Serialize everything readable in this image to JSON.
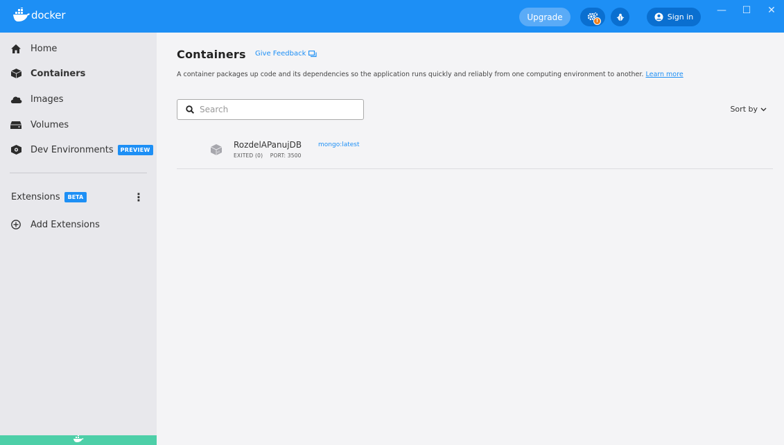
{
  "titlebar": {
    "logo_text": "docker",
    "upgrade_label": "Upgrade",
    "notification_count": "!",
    "signin_label": "Sign in",
    "minimize_glyph": "—",
    "maximize_glyph": "☐",
    "close_glyph": "✕"
  },
  "sidebar": {
    "items": [
      {
        "label": "Home",
        "icon": "home-icon"
      },
      {
        "label": "Containers",
        "icon": "containers-icon"
      },
      {
        "label": "Images",
        "icon": "images-icon"
      },
      {
        "label": "Volumes",
        "icon": "volumes-icon"
      },
      {
        "label": "Dev Environments",
        "icon": "dev-env-icon",
        "badge": "PREVIEW"
      }
    ],
    "extensions_label": "Extensions",
    "extensions_badge": "BETA",
    "add_extensions_label": "Add Extensions"
  },
  "main": {
    "title": "Containers",
    "feedback_label": "Give Feedback",
    "description": "A container packages up code and its dependencies so the application runs quickly and reliably from one computing environment to another.",
    "learn_more": "Learn more",
    "search_placeholder": "Search",
    "sort_label": "Sort by",
    "containers": [
      {
        "name": "RozdelAPanujDB",
        "image": "mongo:latest",
        "status": "EXITED (0)",
        "port": "PORT: 3500"
      }
    ]
  },
  "colors": {
    "accent": "#1d8ff5",
    "sidebar_bg": "#e8e8ec",
    "main_bg": "#f4f4f6",
    "footer": "#4dcfa8",
    "warning": "#ee7f1b"
  }
}
